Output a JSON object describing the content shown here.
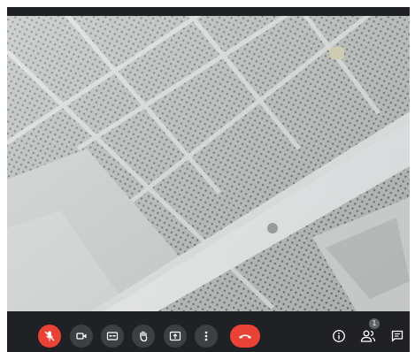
{
  "participants_badge": "1",
  "controls": {
    "icons": [
      "mic-off-icon",
      "camera-icon",
      "captions-icon",
      "raise-hand-icon",
      "present-icon",
      "more-options-icon",
      "end-call-icon",
      "info-icon",
      "people-icon",
      "chat-icon"
    ]
  },
  "colors": {
    "bar": "#202124",
    "button": "#3c4043",
    "danger": "#ea4335",
    "ceiling": "#c9cdcb"
  }
}
